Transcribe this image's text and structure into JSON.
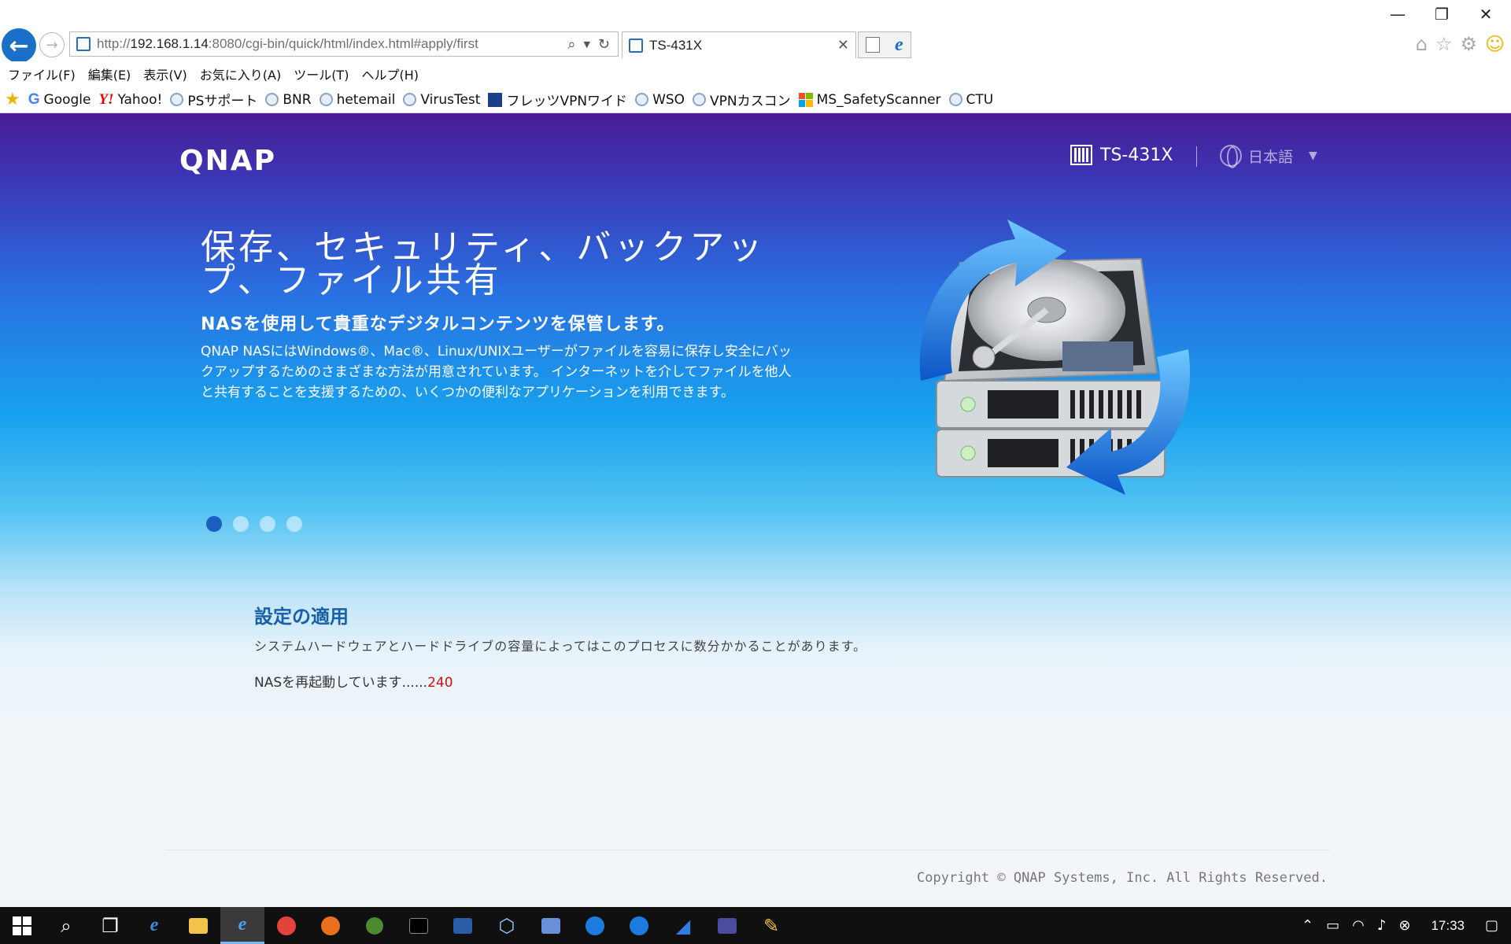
{
  "browser": {
    "url_prefix": "http://",
    "url_host": "192.168.1.14",
    "url_path": ":8080/cgi-bin/quick/html/index.html#apply/first",
    "tab_title": "TS-431X"
  },
  "menu": [
    "ファイル(F)",
    "編集(E)",
    "表示(V)",
    "お気に入り(A)",
    "ツール(T)",
    "ヘルプ(H)"
  ],
  "favorites": [
    "Google",
    "Yahoo!",
    "PSサポート",
    "BNR",
    "hetemail",
    "VirusTest",
    "フレッツVPNワイド",
    "WSO",
    "VPNカスコン",
    "MS_SafetyScanner",
    "CTU"
  ],
  "header": {
    "logo": "QNAP",
    "model": "TS-431X",
    "language": "日本語"
  },
  "hero": {
    "title": "保存、セキュリティ、バックアップ、ファイル共有",
    "subtitle": "NASを使用して貴重なデジタルコンテンツを保管します。",
    "description": "QNAP NASにはWindows®、Mac®、Linux/UNIXユーザーがファイルを容易に保存し安全にバックアップするためのさまざまな方法が用意されています。 インターネットを介してファイルを他人と共有することを支援するための、いくつかの便利なアプリケーションを利用できます。"
  },
  "apply": {
    "title": "設定の適用",
    "description": "システムハードウェアとハードドライブの容量によってはこのプロセスに数分かかることがあります。",
    "restart_label": "NASを再起動しています......",
    "restart_count": "240"
  },
  "footer": {
    "copyright": "Copyright © QNAP Systems, Inc. All Rights Reserved."
  },
  "taskbar": {
    "clock": "17:33"
  },
  "colors": {
    "accent": "#1a5fa8",
    "countdown": "#d01010"
  }
}
